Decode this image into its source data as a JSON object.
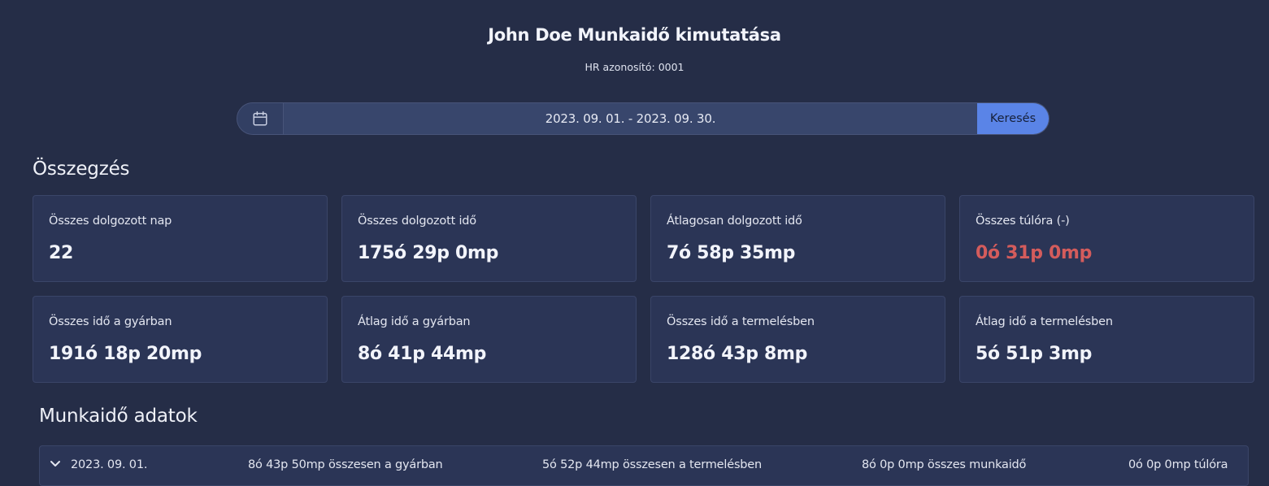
{
  "header": {
    "title": "John Doe Munkaidő kimutatása",
    "subtitle": "HR azonosító: 0001"
  },
  "search": {
    "calendar_icon": "calendar-icon",
    "date_range": "2023. 09. 01. - 2023. 09. 30.",
    "button_label": "Keresés"
  },
  "summary": {
    "title": "Összegzés",
    "cards": [
      {
        "label": "Összes dolgozott nap",
        "value": "22"
      },
      {
        "label": "Összes dolgozott idő",
        "value": "175ó 29p 0mp"
      },
      {
        "label": "Átlagosan dolgozott idő",
        "value": "7ó 58p 35mp"
      },
      {
        "label": "Összes túlóra (-)",
        "value": "0ó 31p 0mp"
      },
      {
        "label": "Összes idő a gyárban",
        "value": "191ó 18p 20mp"
      },
      {
        "label": "Átlag idő a gyárban",
        "value": "8ó 41p 44mp"
      },
      {
        "label": "Összes idő a termelésben",
        "value": "128ó 43p 8mp"
      },
      {
        "label": "Átlag idő a termelésben",
        "value": "5ó 51p 3mp"
      }
    ]
  },
  "worktime": {
    "title": "Munkaidő adatok",
    "rows": [
      {
        "expand_icon": "chevron-down-icon",
        "date": "2023. 09. 01.",
        "factory": "8ó 43p 50mp összesen a gyárban",
        "production": "5ó 52p 44mp összesen a termelésben",
        "total": "8ó 0p 0mp összes munkaidő",
        "overtime": "0ó 0p 0mp túlóra"
      }
    ]
  },
  "colors": {
    "background": "#252d47",
    "card": "#2b3556",
    "accent": "#5a84e7",
    "negative": "#d45c5c"
  }
}
